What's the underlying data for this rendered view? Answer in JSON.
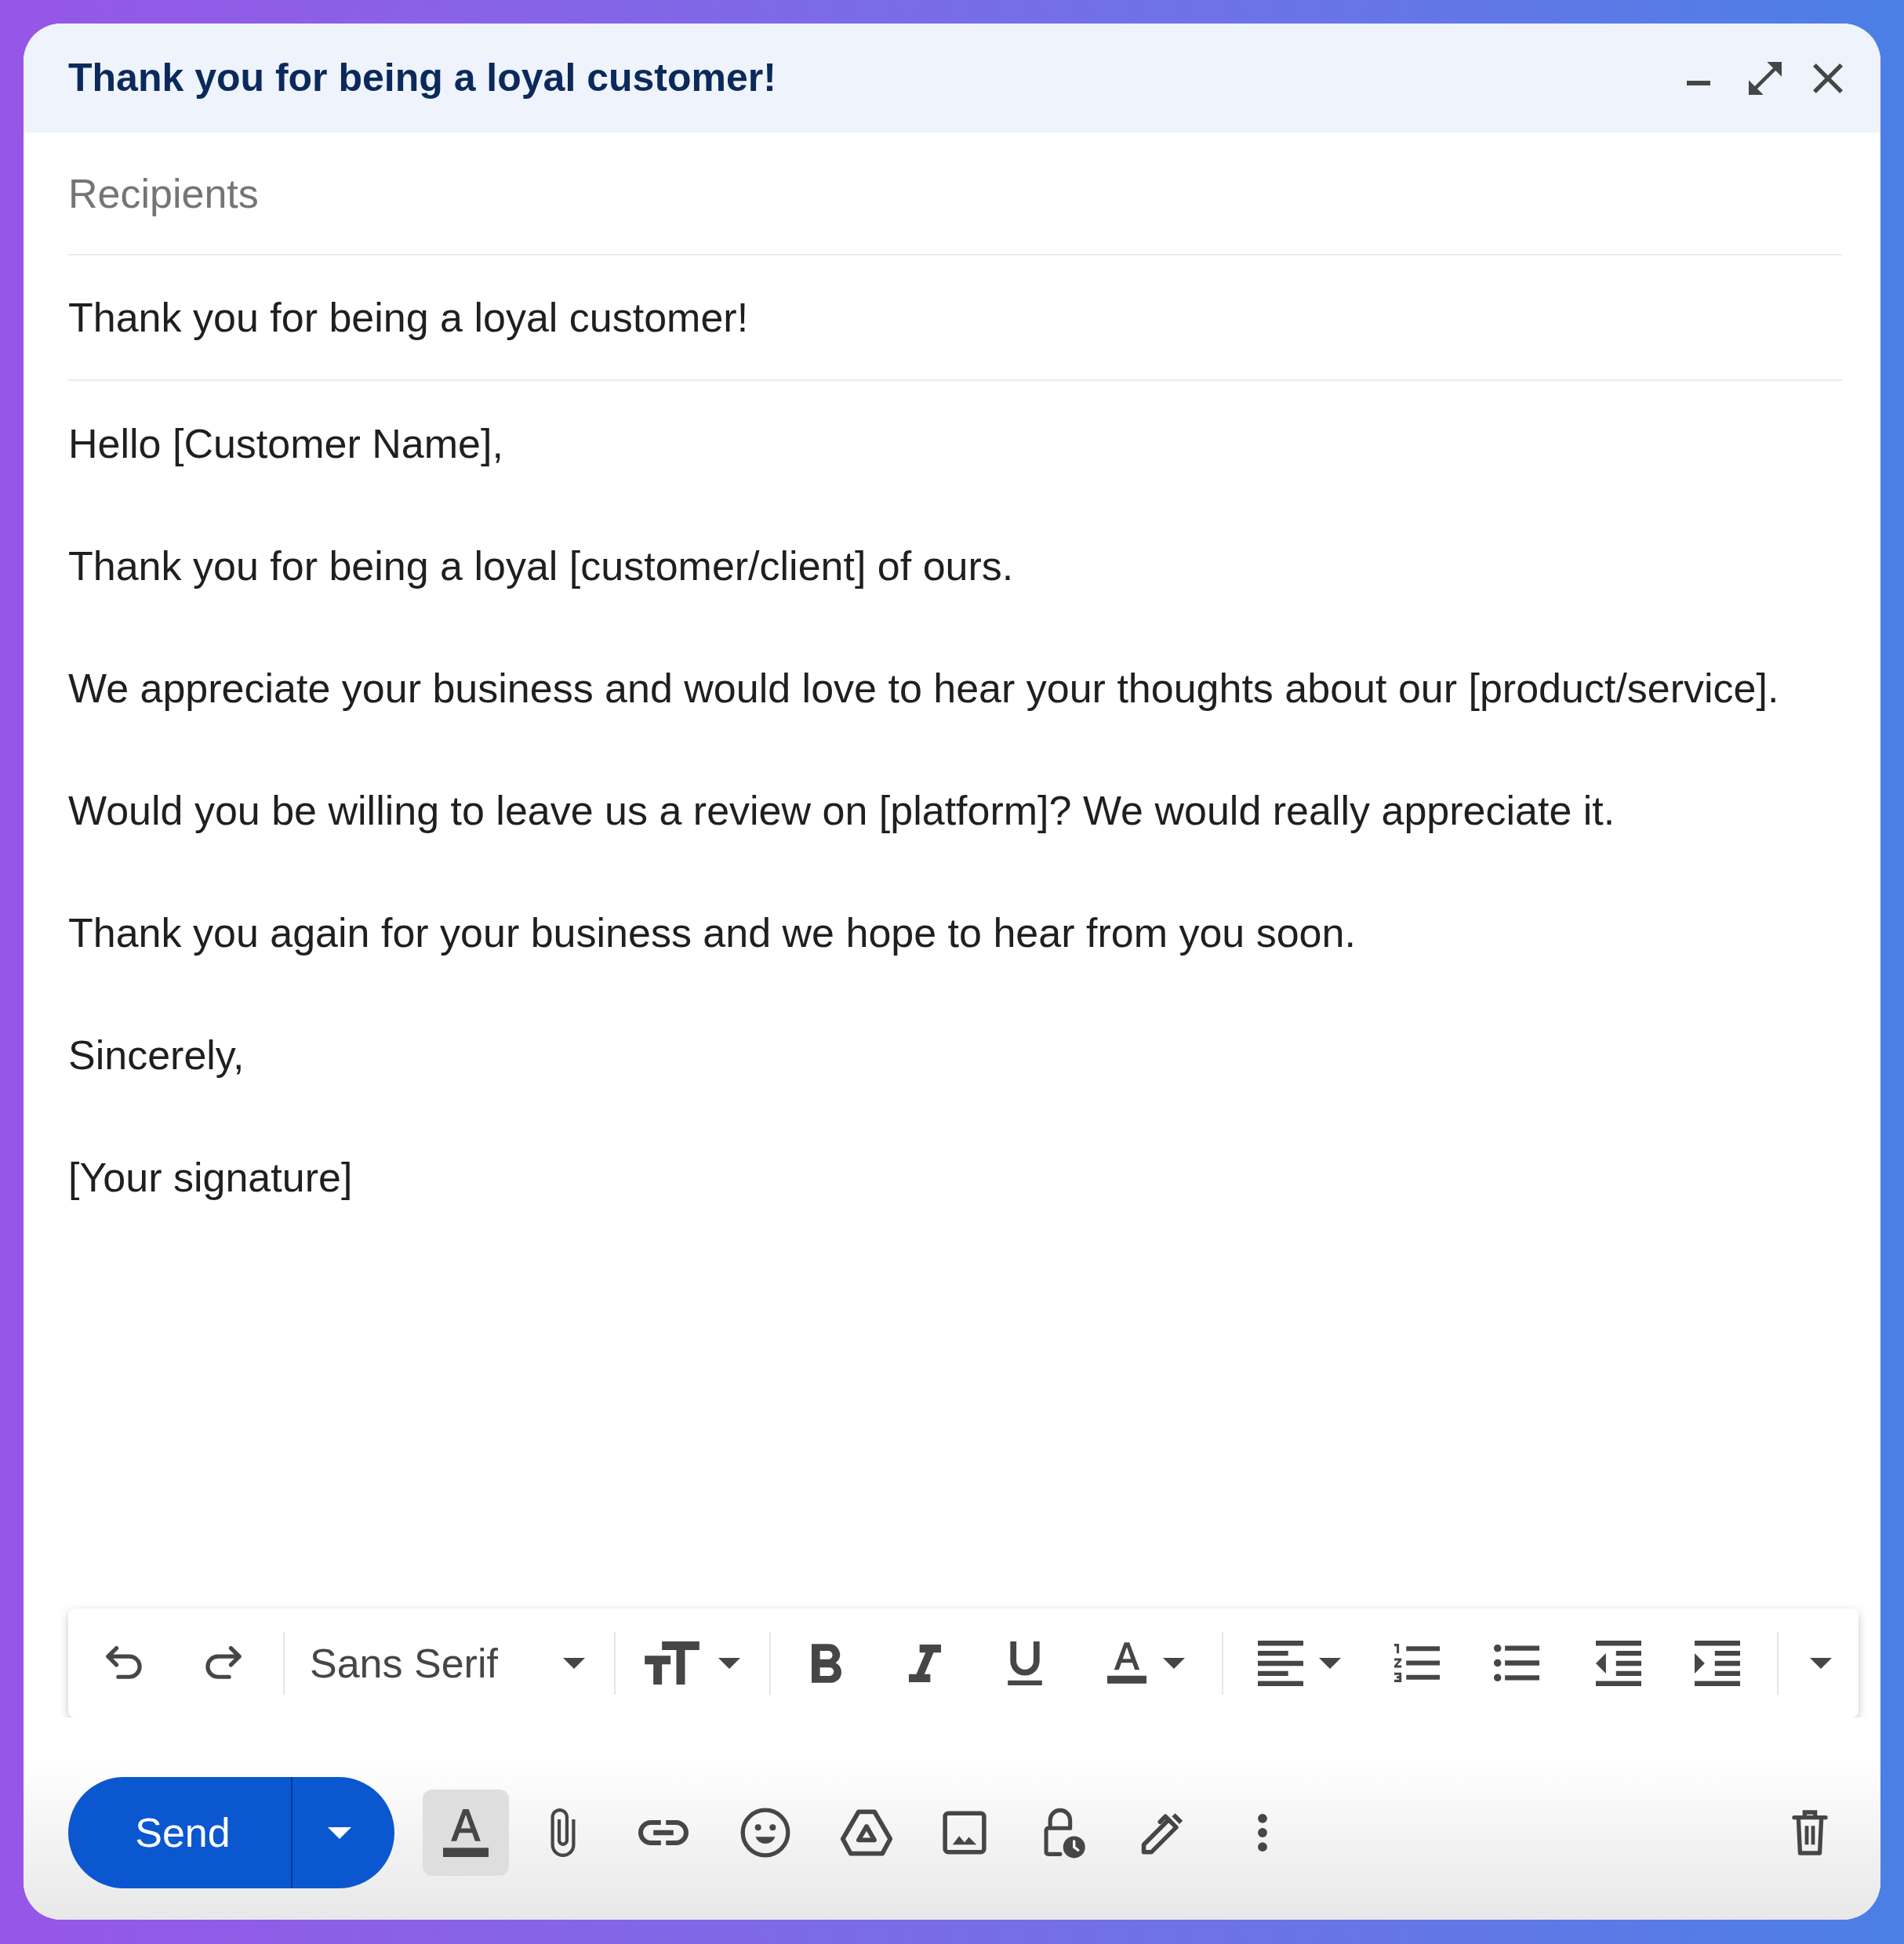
{
  "window": {
    "title": "Thank you for being a loyal customer!"
  },
  "recipients": {
    "placeholder": "Recipients"
  },
  "subject": {
    "value": "Thank you for being a loyal customer!"
  },
  "body": {
    "paragraphs": [
      "Hello [Customer Name],",
      "Thank you for being a loyal [customer/client] of ours.",
      "We appreciate your business and would love to hear your thoughts about our [product/service].",
      "Would you be willing to leave us a review on [platform]? We would really appreciate it.",
      "Thank you again for your business and we hope to hear from you soon.",
      "Sincerely,",
      "[Your signature]"
    ]
  },
  "formatting_toolbar": {
    "font": "Sans Serif"
  },
  "action_bar": {
    "send": "Send",
    "formatting_options": {
      "selected": true
    }
  }
}
